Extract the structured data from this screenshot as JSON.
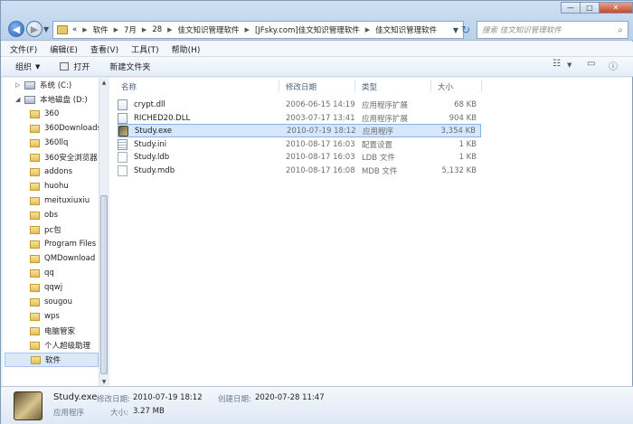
{
  "window": {
    "controls": [
      "—",
      "□",
      "✕"
    ]
  },
  "address": {
    "crumbs": [
      "«",
      "软件",
      "7月",
      "28",
      "佳文知识管理软件",
      "[JFsky.com]佳文知识管理软件",
      "佳文知识管理软件"
    ],
    "search_placeholder": "搜索 佳文知识管理软件"
  },
  "menu": [
    "文件(F)",
    "编辑(E)",
    "查看(V)",
    "工具(T)",
    "帮助(H)"
  ],
  "toolbar": {
    "organize": "组织",
    "open": "打开",
    "new_folder": "新建文件夹"
  },
  "sidebar": {
    "items": [
      {
        "label": "系统 (C:)",
        "kind": "drive"
      },
      {
        "label": "本地磁盘 (D:)",
        "kind": "drive"
      },
      {
        "label": "360",
        "kind": "folder"
      },
      {
        "label": "360Downloads",
        "kind": "folder"
      },
      {
        "label": "360llq",
        "kind": "folder"
      },
      {
        "label": "360安全浏览器",
        "kind": "folder"
      },
      {
        "label": "addons",
        "kind": "folder"
      },
      {
        "label": "huohu",
        "kind": "folder"
      },
      {
        "label": "meituxiuxiu",
        "kind": "folder"
      },
      {
        "label": "obs",
        "kind": "folder"
      },
      {
        "label": "pc包",
        "kind": "folder"
      },
      {
        "label": "Program Files",
        "kind": "folder"
      },
      {
        "label": "QMDownload",
        "kind": "folder"
      },
      {
        "label": "qq",
        "kind": "folder"
      },
      {
        "label": "qqwj",
        "kind": "folder"
      },
      {
        "label": "sougou",
        "kind": "folder"
      },
      {
        "label": "wps",
        "kind": "folder"
      },
      {
        "label": "电脑管家",
        "kind": "folder"
      },
      {
        "label": "个人超级助理",
        "kind": "folder"
      },
      {
        "label": "软件",
        "kind": "folder",
        "selected": true
      }
    ]
  },
  "columns": {
    "name": "名称",
    "date": "修改日期",
    "type": "类型",
    "size": "大小"
  },
  "files": [
    {
      "name": "crypt.dll",
      "date": "2006-06-15 14:19",
      "type": "应用程序扩展",
      "size": "68 KB",
      "icon": "dll"
    },
    {
      "name": "RICHED20.DLL",
      "date": "2003-07-17 13:41",
      "type": "应用程序扩展",
      "size": "904 KB",
      "icon": "dll"
    },
    {
      "name": "Study.exe",
      "date": "2010-07-19 18:12",
      "type": "应用程序",
      "size": "3,354 KB",
      "icon": "exe",
      "selected": true
    },
    {
      "name": "Study.ini",
      "date": "2010-08-17 16:03",
      "type": "配置设置",
      "size": "1 KB",
      "icon": "ini"
    },
    {
      "name": "Study.ldb",
      "date": "2010-08-17 16:03",
      "type": "LDB 文件",
      "size": "1 KB",
      "icon": "blank"
    },
    {
      "name": "Study.mdb",
      "date": "2010-08-17 16:08",
      "type": "MDB 文件",
      "size": "5,132 KB",
      "icon": "blank"
    }
  ],
  "details": {
    "name": "Study.exe",
    "modified_label": "修改日期:",
    "modified": "2010-07-19 18:12",
    "created_label": "创建日期:",
    "created": "2020-07-28 11:47",
    "type": "应用程序",
    "size_label": "大小:",
    "size": "3.27 MB"
  }
}
